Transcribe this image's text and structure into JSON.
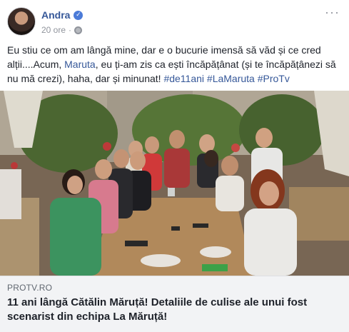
{
  "post": {
    "author": "Andra",
    "verified_icon": "verified-badge",
    "time": "20 ore",
    "dot": "·",
    "privacy_icon": "globe-icon",
    "more_icon": "more-icon"
  },
  "text": {
    "line1": "Eu stiu ce om am lângă mine, dar e o bucurie imensă să văd și ce cred",
    "line2_a": "alții....Acum, ",
    "mention": "Maruta",
    "line2_b": ", eu ți-am zis ca ești încăpățânat (și te încăpățânezi să",
    "line3_a": "nu mă crezi), haha, dar și minunat! ",
    "hashtags": [
      "#de11ani",
      "#LaMaruta",
      "#ProTv"
    ]
  },
  "link_preview": {
    "source": "PROTV.RO",
    "title": "11 ani lângă Cătălin Măruță! Detaliile de culise ale unui fost scenarist din echipa La Măruță!"
  },
  "colors": {
    "link": "#365899",
    "text": "#1d2129",
    "meta": "#90949c",
    "caption_bg": "#f2f3f5"
  }
}
